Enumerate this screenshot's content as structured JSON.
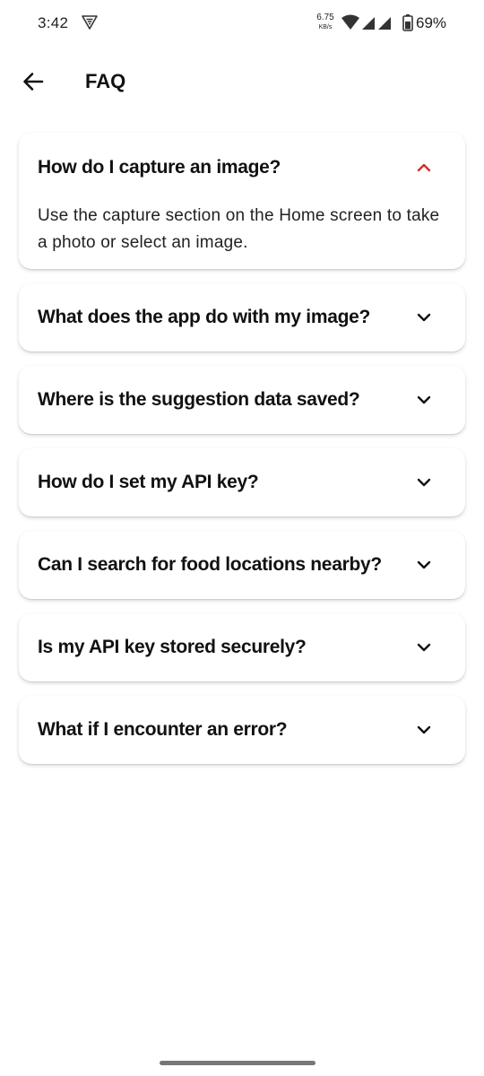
{
  "status_bar": {
    "time": "3:42",
    "net_speed_value": "6.75",
    "net_speed_unit": "KB/s",
    "battery": "69%",
    "icons": [
      "vpn-icon",
      "wifi-icon",
      "signal-icon",
      "battery-icon"
    ]
  },
  "header": {
    "title": "FAQ",
    "back_icon": "arrow-left-icon"
  },
  "colors": {
    "accent_expanded": "#d32f2f",
    "text": "#111111"
  },
  "faq": [
    {
      "question": "How do I capture an image?",
      "answer": "Use the capture section on the Home screen to take a photo or select an image.",
      "expanded": true
    },
    {
      "question": "What does the app do with my image?",
      "expanded": false
    },
    {
      "question": "Where is the suggestion data saved?",
      "expanded": false
    },
    {
      "question": "How do I set my API key?",
      "expanded": false
    },
    {
      "question": "Can I search for food locations nearby?",
      "expanded": false
    },
    {
      "question": "Is my API key stored securely?",
      "expanded": false
    },
    {
      "question": "What if I encounter an error?",
      "expanded": false
    }
  ]
}
